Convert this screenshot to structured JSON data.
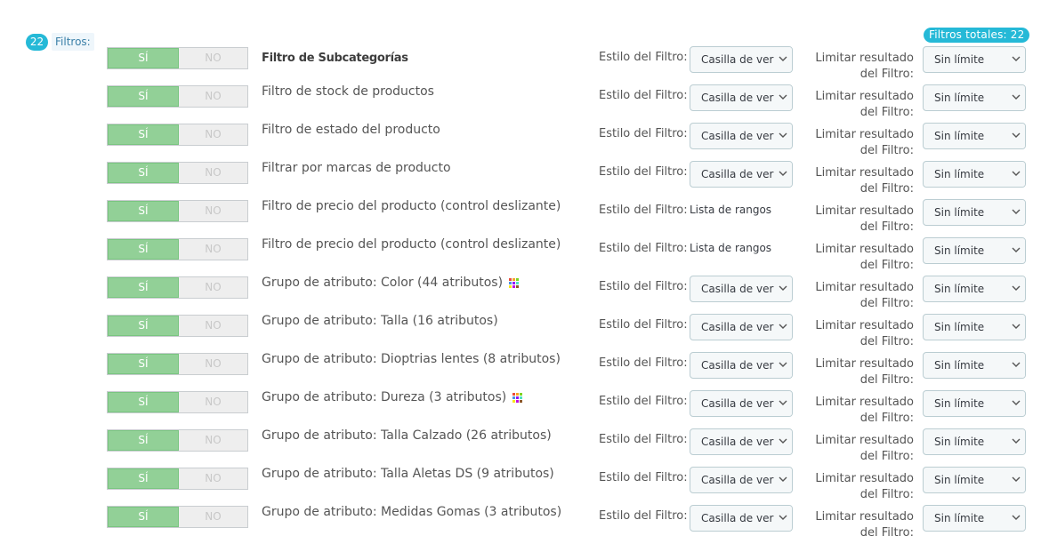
{
  "header": {
    "total_badge": "Filtros totales: 22",
    "count": "22",
    "filters_label": "Filtros:"
  },
  "labels": {
    "yes": "SÍ",
    "no": "NO",
    "style": "Estilo del Filtro:",
    "limit_line1": "Limitar resultado",
    "limit_line2": "del Filtro:"
  },
  "colors": {
    "accent": "#25b9d7",
    "toggle_on": "#92d097"
  },
  "filters": [
    {
      "name": "Filtro de Subcategorías",
      "style_type": "select",
      "style_value": "Casilla de verificación",
      "limit_value": "Sin límite",
      "icon": ""
    },
    {
      "name": "Filtro de stock de productos",
      "style_type": "select",
      "style_value": "Casilla de verificación",
      "limit_value": "Sin límite",
      "icon": ""
    },
    {
      "name": "Filtro de estado del producto",
      "style_type": "select",
      "style_value": "Casilla de verificación",
      "limit_value": "Sin límite",
      "icon": ""
    },
    {
      "name": "Filtrar por marcas de producto",
      "style_type": "select",
      "style_value": "Casilla de verificación",
      "limit_value": "Sin límite",
      "icon": ""
    },
    {
      "name": "Filtro de precio del producto (control deslizante)",
      "style_type": "text",
      "style_value": "Lista de rangos",
      "limit_value": "Sin límite",
      "icon": ""
    },
    {
      "name": "Filtro de precio del producto (control deslizante)",
      "style_type": "text",
      "style_value": "Lista de rangos",
      "limit_value": "Sin límite",
      "icon": ""
    },
    {
      "name": "Grupo de atributo: Color (44 atributos)",
      "style_type": "select",
      "style_value": "Casilla de verificación",
      "limit_value": "Sin límite",
      "icon": "color-grid-icon"
    },
    {
      "name": "Grupo de atributo: Talla (16 atributos)",
      "style_type": "select",
      "style_value": "Casilla de verificación",
      "limit_value": "Sin límite",
      "icon": ""
    },
    {
      "name": "Grupo de atributo: Dioptrias lentes (8 atributos)",
      "style_type": "select",
      "style_value": "Casilla de verificación",
      "limit_value": "Sin límite",
      "icon": ""
    },
    {
      "name": "Grupo de atributo: Dureza (3 atributos)",
      "style_type": "select",
      "style_value": "Casilla de verificación",
      "limit_value": "Sin límite",
      "icon": "color-grid-icon"
    },
    {
      "name": "Grupo de atributo: Talla Calzado (26 atributos)",
      "style_type": "select",
      "style_value": "Casilla de verificación",
      "limit_value": "Sin límite",
      "icon": ""
    },
    {
      "name": "Grupo de atributo: Talla Aletas DS (9 atributos)",
      "style_type": "select",
      "style_value": "Casilla de verificación",
      "limit_value": "Sin límite",
      "icon": ""
    },
    {
      "name": "Grupo de atributo: Medidas Gomas (3 atributos)",
      "style_type": "select",
      "style_value": "Casilla de verificación",
      "limit_value": "Sin límite",
      "icon": ""
    }
  ]
}
